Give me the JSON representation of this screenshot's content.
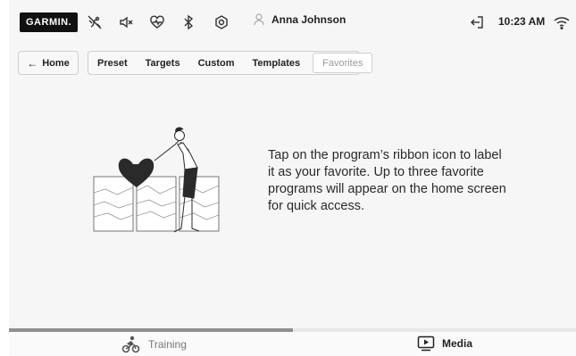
{
  "topbar": {
    "logo": "GARMIN.",
    "user_name": "Anna Johnson",
    "time": "10:23 AM",
    "icons": [
      "no-heart-rate-sensor-icon",
      "volume-muted-icon",
      "heart-rate-icon",
      "bluetooth-icon",
      "settings-icon",
      "user-avatar-icon",
      "logout-icon",
      "wifi-icon"
    ]
  },
  "nav": {
    "home_label": "Home",
    "tabs": [
      {
        "label": "Preset"
      },
      {
        "label": "Targets"
      },
      {
        "label": "Custom"
      },
      {
        "label": "Templates"
      },
      {
        "label": "Favorites",
        "active": true
      }
    ]
  },
  "main": {
    "message": "Tap on the program’s ribbon icon to label it as your favorite. Up to three favorite programs will appear on the home screen for quick access."
  },
  "bottom": {
    "progress": 0.5,
    "tabs": [
      {
        "label": "Training",
        "icon": "cyclist-icon"
      },
      {
        "label": "Media",
        "icon": "play-screen-icon",
        "active": true
      }
    ]
  },
  "colors": {
    "background": "#f6f6f6",
    "text": "#222222",
    "muted": "#9a9a9a",
    "progress": "#8f8f8f"
  }
}
